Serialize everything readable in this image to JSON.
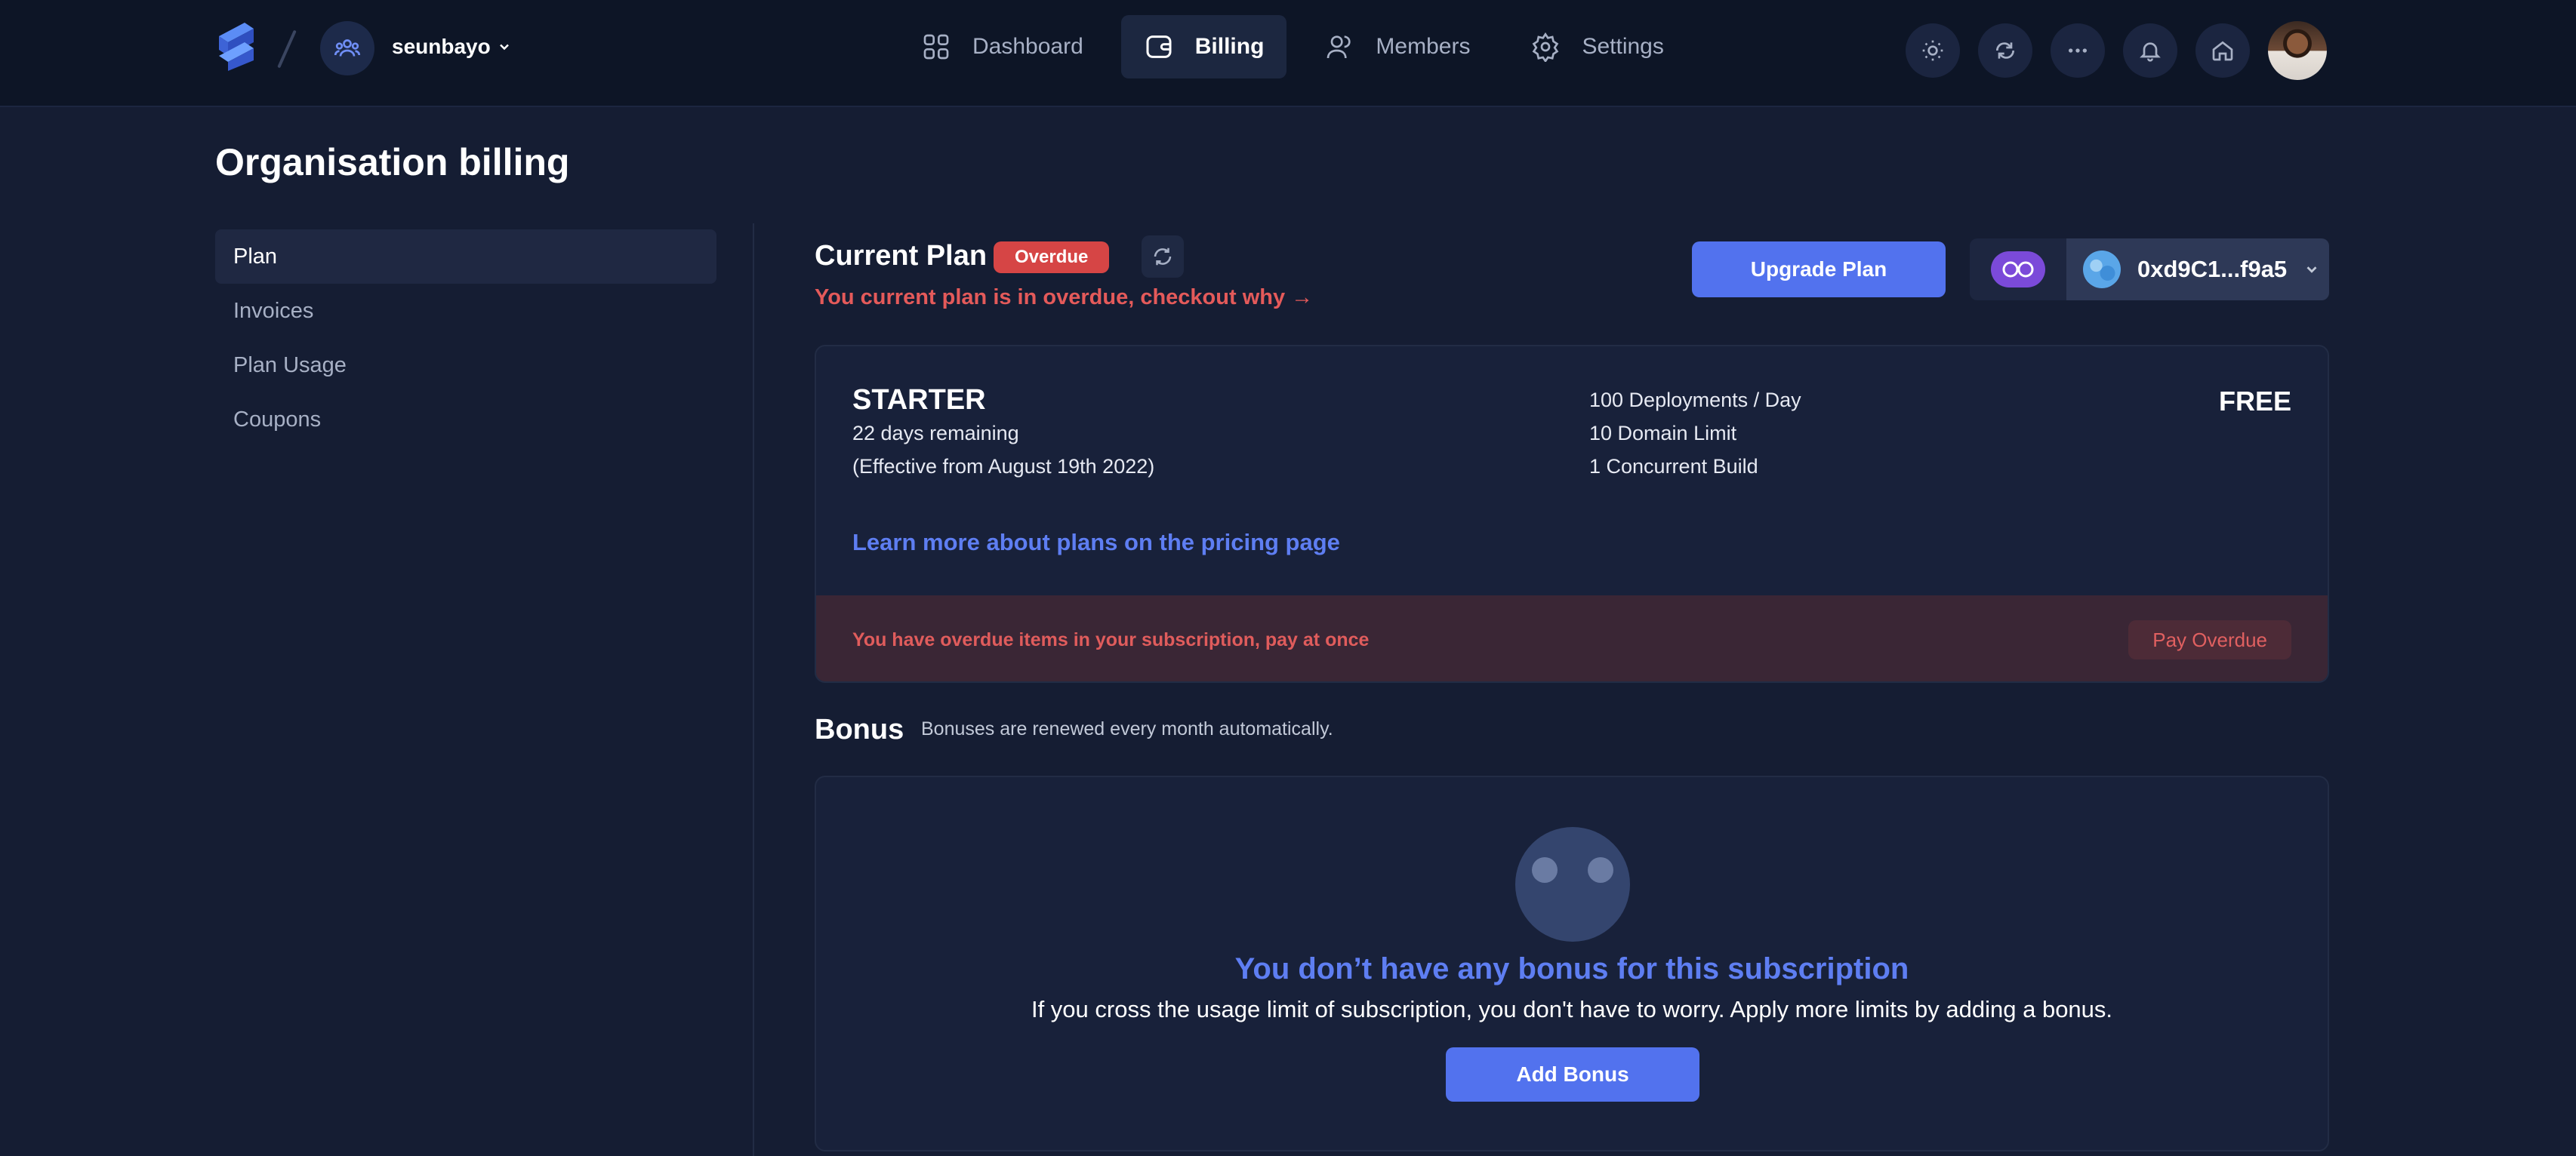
{
  "nav": {
    "team_name": "seunbayo",
    "items": [
      {
        "label": "Dashboard",
        "icon": "grid-icon"
      },
      {
        "label": "Billing",
        "icon": "wallet-icon"
      },
      {
        "label": "Members",
        "icon": "users-icon"
      },
      {
        "label": "Settings",
        "icon": "gear-icon"
      }
    ],
    "active": "Billing",
    "actions": [
      "sun-icon",
      "sync-icon",
      "more-icon",
      "bell-icon",
      "home-icon"
    ]
  },
  "page": {
    "title": "Organisation billing"
  },
  "sidebar": {
    "items": [
      {
        "label": "Plan"
      },
      {
        "label": "Invoices"
      },
      {
        "label": "Plan Usage"
      },
      {
        "label": "Coupons"
      }
    ],
    "active": "Plan"
  },
  "current_plan": {
    "title": "Current Plan",
    "status_badge": "Overdue",
    "overdue_note": "You current plan is in overdue, checkout why →",
    "upgrade_label": "Upgrade Plan",
    "wallet_address": "0xd9C1...f9a5"
  },
  "plan_card": {
    "name": "STARTER",
    "remaining": "22 days remaining",
    "effective": "(Effective from August 19th 2022)",
    "features": [
      "100 Deployments / Day",
      "10 Domain Limit",
      "1 Concurrent Build"
    ],
    "price": "FREE",
    "learn_more": "Learn more about plans on the pricing page",
    "overdue_message": "You have overdue items in your subscription, pay at once",
    "pay_label": "Pay Overdue"
  },
  "bonus": {
    "title": "Bonus",
    "subtitle": "Bonuses are renewed every month automatically.",
    "empty_title": "You don’t have any bonus for this subscription",
    "empty_desc": "If you cross the usage limit of subscription, you don't have to worry. Apply more limits by adding a bonus.",
    "add_label": "Add Bonus"
  },
  "colors": {
    "background": "#151d33",
    "topbar": "#0d1526",
    "accent": "#5272ee",
    "danger": "#d64545"
  }
}
